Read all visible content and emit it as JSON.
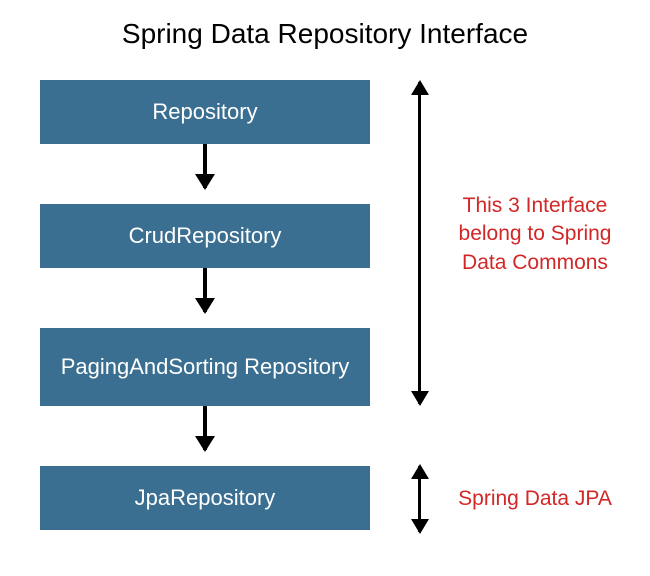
{
  "title": "Spring Data Repository Interface",
  "boxes": {
    "b1": "Repository",
    "b2": "CrudRepository",
    "b3": "PagingAndSorting Repository",
    "b4": "JpaRepository"
  },
  "annotations": {
    "commons": "This 3 Interface belong to Spring Data Commons",
    "jpa": "Spring Data JPA"
  },
  "colors": {
    "box_fill": "#3b6f91",
    "box_text": "#ffffff",
    "annotation_text": "#d22727"
  }
}
